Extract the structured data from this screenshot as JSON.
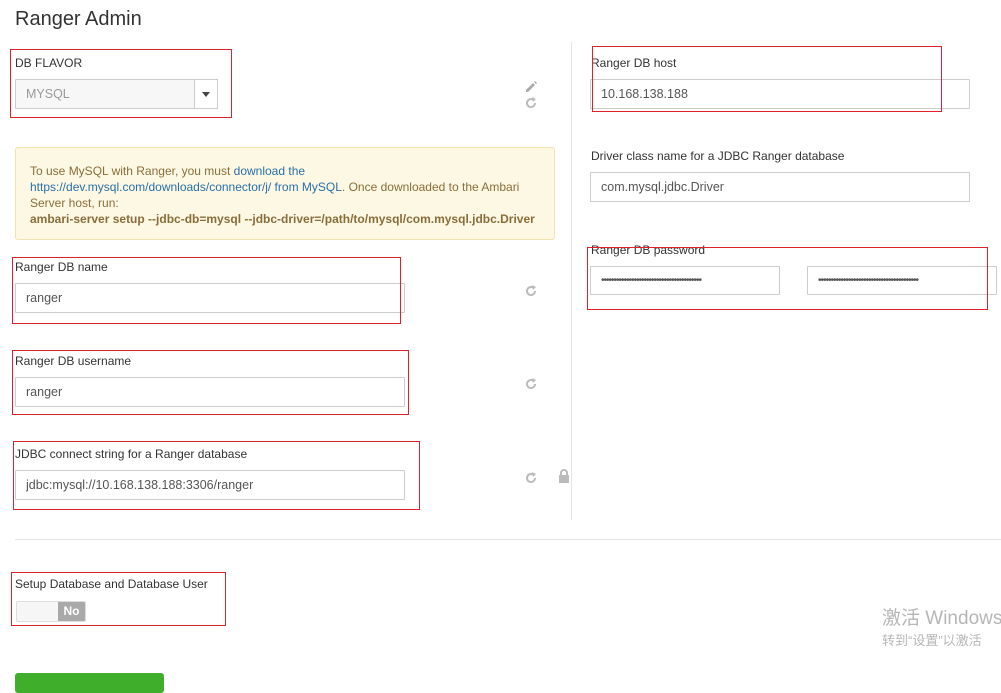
{
  "page": {
    "title": "Ranger Admin"
  },
  "db_flavor": {
    "label": "DB FLAVOR",
    "value": "MYSQL"
  },
  "alert": {
    "text_before": "To use MySQL with Ranger, you must ",
    "link_text": "download the https://dev.mysql.com/downloads/connector/j/ from MySQL",
    "text_after": ". Once downloaded to the Ambari Server host, run:",
    "command": "ambari-server setup --jdbc-db=mysql --jdbc-driver=/path/to/mysql/com.mysql.jdbc.Driver"
  },
  "db_name": {
    "label": "Ranger DB name",
    "value": "ranger"
  },
  "db_username": {
    "label": "Ranger DB username",
    "value": "ranger"
  },
  "jdbc_url": {
    "label": "JDBC connect string for a Ranger database",
    "value": "jdbc:mysql://10.168.138.188:3306/ranger"
  },
  "db_host": {
    "label": "Ranger DB host",
    "value": "10.168.138.188"
  },
  "driver": {
    "label": "Driver class name for a JDBC Ranger database",
    "value": "com.mysql.jdbc.Driver"
  },
  "db_password": {
    "label": "Ranger DB password",
    "value": "••••••••••••••••••••••••••••••••••••••••",
    "confirm": "••••••••••••••••••••••••••••••••••••••••"
  },
  "setup_db": {
    "label": "Setup Database and Database User",
    "toggle_value": "No"
  },
  "watermark": {
    "line1": "激活 Windows",
    "line2": "转到“设置”以激活"
  },
  "colors": {
    "highlight": "#e0202a",
    "primary_button": "#3fae2a",
    "link": "#2a6fa8"
  },
  "icons": {
    "edit": "pencil-icon",
    "reset": "refresh-icon",
    "lock": "lock-icon",
    "dropdown": "caret-down-icon"
  }
}
